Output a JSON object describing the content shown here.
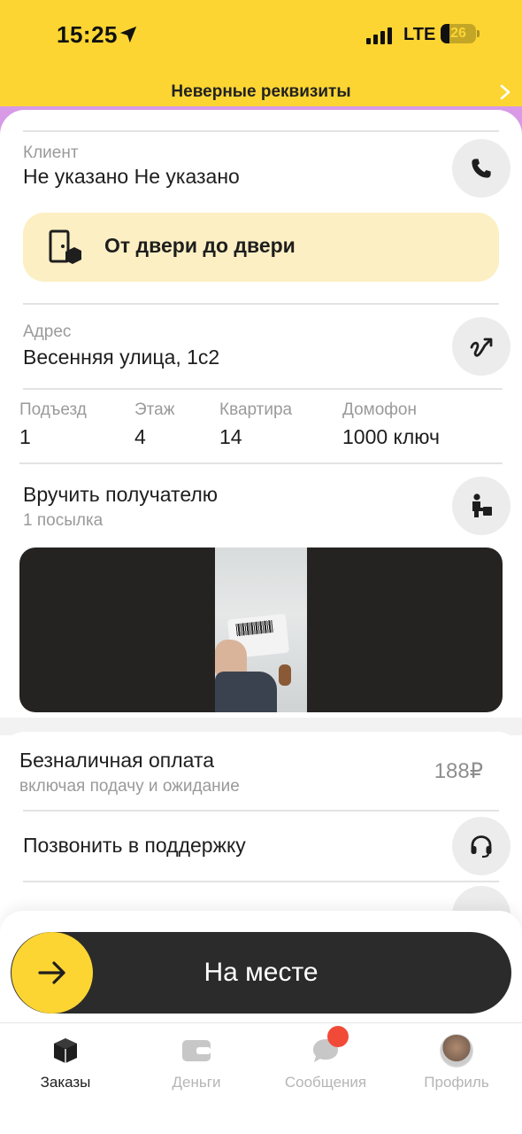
{
  "status_bar": {
    "time": "15:25",
    "network": "LTE",
    "battery": "26",
    "battery_percent": 26
  },
  "banner": {
    "text": "Неверные реквизиты"
  },
  "client": {
    "label": "Клиент",
    "name": "Не указано Не указано"
  },
  "delivery_type": {
    "label": "От двери до двери"
  },
  "address": {
    "label": "Адрес",
    "value": "Весенняя улица, 1с2"
  },
  "address_details": [
    {
      "label": "Подъезд",
      "value": "1"
    },
    {
      "label": "Этаж",
      "value": "4"
    },
    {
      "label": "Квартира",
      "value": "14"
    },
    {
      "label": "Домофон",
      "value": "1000 ключ"
    }
  ],
  "handover": {
    "title": "Вручить получателю",
    "subtitle": "1 посылка"
  },
  "payment": {
    "title": "Безналичная оплата",
    "subtitle": "включая подачу и ожидание",
    "amount": "188₽"
  },
  "support": {
    "label": "Позвонить в поддержку"
  },
  "action": {
    "label": "На месте"
  },
  "tabs": [
    {
      "label": "Заказы",
      "icon": "box-icon",
      "active": true
    },
    {
      "label": "Деньги",
      "icon": "wallet-icon",
      "active": false
    },
    {
      "label": "Сообщения",
      "icon": "chat-icon",
      "active": false
    },
    {
      "label": "Профиль",
      "icon": "avatar",
      "active": false
    }
  ],
  "colors": {
    "brand_yellow": "#fcd533",
    "dark": "#2c2b2b",
    "chip": "#fcefc3",
    "badge": "#f24a39"
  }
}
